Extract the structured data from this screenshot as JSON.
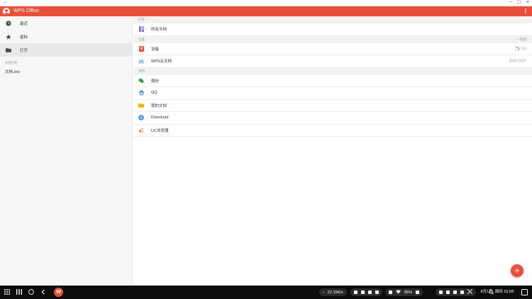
{
  "window": {
    "back_icon": "arrow-left-icon",
    "minimize_label": "−",
    "maximize_label": "□",
    "close_label": "×"
  },
  "appbar": {
    "title": "WPS Office",
    "more_label": "⋮",
    "color": "#e94f3b"
  },
  "sidebar": {
    "items": [
      {
        "label": "最近",
        "icon": "clock-icon"
      },
      {
        "label": "星标",
        "icon": "star-icon"
      },
      {
        "label": "打开",
        "icon": "folder-icon",
        "active": true
      }
    ],
    "recent_section_label": "文档历史",
    "recent_files": [
      "文档.doc"
    ]
  },
  "main": {
    "open_section": {
      "label": "打开",
      "items": [
        {
          "label": "所有文档",
          "icon": "all-docs-icon"
        }
      ]
    },
    "storage_section": {
      "label": "位置",
      "right_label": "+ 新建",
      "items": [
        {
          "label": "设备",
          "icon": "device-icon",
          "right": "可用"
        },
        {
          "label": "WPS云文档",
          "icon": "cloud-icon",
          "right": "登录后可同步"
        }
      ]
    },
    "common_section": {
      "label": "常用",
      "items": [
        {
          "label": "微信",
          "icon": "wechat-icon"
        },
        {
          "label": "QQ",
          "icon": "qq-icon"
        },
        {
          "label": "我的文档",
          "icon": "folder-yellow-icon"
        },
        {
          "label": "Download",
          "icon": "download-icon"
        },
        {
          "label": "UC浏览器",
          "icon": "uc-browser-icon"
        }
      ]
    },
    "fab_label": "+"
  },
  "taskbar": {
    "app_label": "W",
    "network_speed": "22.15K/s",
    "battery": "86%",
    "clock": "8月1日, 周四 15:58",
    "expand_label": "›"
  }
}
